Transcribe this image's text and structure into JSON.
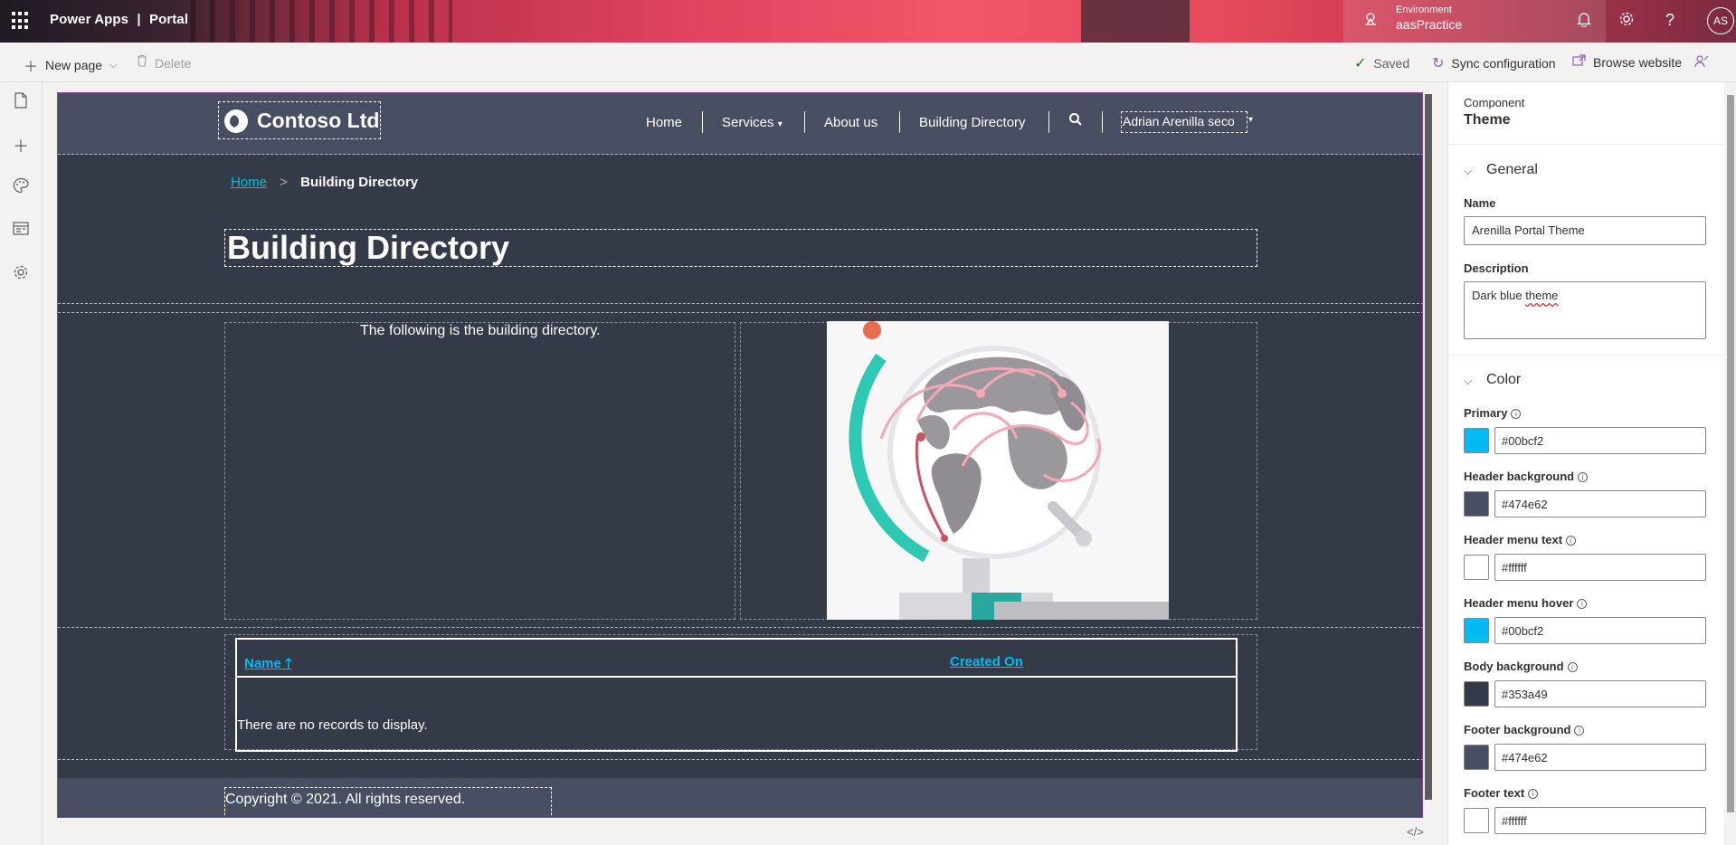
{
  "topbar": {
    "app_name": "Power Apps",
    "separator": "|",
    "product": "Portal",
    "environment_label": "Environment",
    "environment_value": "aasPractice",
    "avatar_initials": "AS"
  },
  "commandbar": {
    "new_page": "New page",
    "delete": "Delete",
    "saved": "Saved",
    "sync": "Sync configuration",
    "browse": "Browse website"
  },
  "site": {
    "logo": "Contoso Ltd",
    "nav": [
      "Home",
      "Services",
      "About us",
      "Building Directory"
    ],
    "user": "Adrian Arenilla seco",
    "breadcrumb_home": "Home",
    "breadcrumb_sep": ">",
    "breadcrumb_current": "Building Directory",
    "title": "Building Directory",
    "intro": "The following is the building directory.",
    "table": {
      "col_name": "Name",
      "col_created": "Created On",
      "empty": "There are no records to display."
    },
    "footer": "Copyright © 2021. All rights reserved."
  },
  "panel": {
    "component_label": "Component",
    "component_value": "Theme",
    "general_title": "General",
    "name_label": "Name",
    "name_value": "Arenilla Portal Theme",
    "description_label": "Description",
    "description_value_prefix": "Dark blue ",
    "description_value_word": "theme",
    "color_title": "Color",
    "colors": [
      {
        "label": "Primary",
        "value": "#00bcf2"
      },
      {
        "label": "Header background",
        "value": "#474e62"
      },
      {
        "label": "Header menu text",
        "value": "#ffffff"
      },
      {
        "label": "Header menu hover",
        "value": "#00bcf2"
      },
      {
        "label": "Body background",
        "value": "#353a49"
      },
      {
        "label": "Footer background",
        "value": "#474e62"
      },
      {
        "label": "Footer text",
        "value": "#ffffff"
      }
    ]
  },
  "icons": [
    "waffle-icon",
    "environment-icon",
    "bell-icon",
    "gear-icon",
    "help-icon",
    "plus-icon",
    "chevron-down-icon",
    "trash-icon",
    "check-icon",
    "sync-icon",
    "browse-icon",
    "feedback-icon",
    "pages-icon",
    "add-icon",
    "palette-icon",
    "templates-icon",
    "settings-icon",
    "search-icon",
    "code-icon",
    "up-arrow-icon"
  ]
}
